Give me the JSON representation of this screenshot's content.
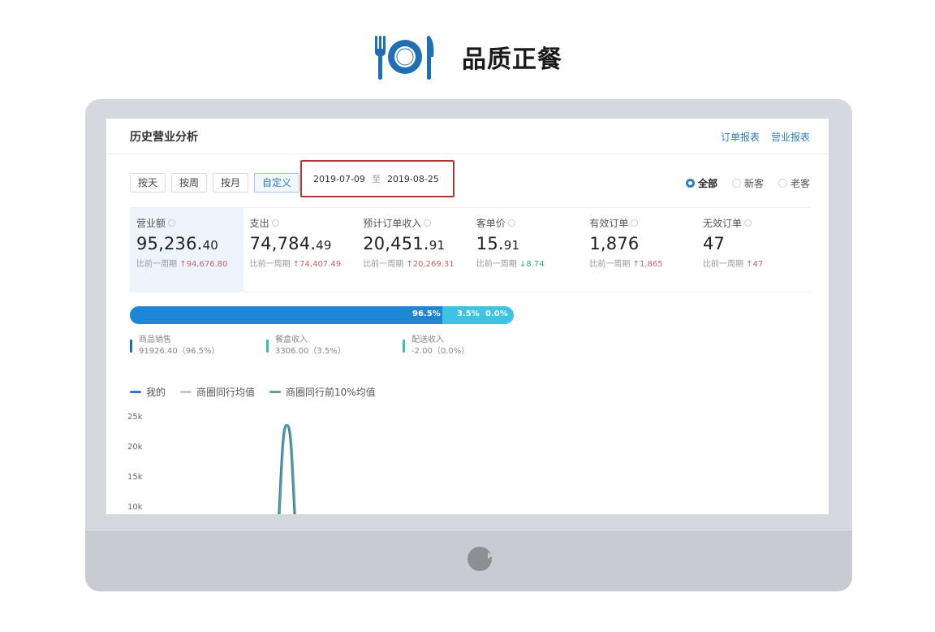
{
  "brand": {
    "title": "品质正餐",
    "logo_icon": "plate-fork-knife-icon",
    "accent": "#1f6fb5"
  },
  "screen": {
    "title": "历史营业分析",
    "links": [
      "订单报表",
      "营业报表"
    ],
    "period_buttons": [
      "按天",
      "按周",
      "按月",
      "自定义"
    ],
    "active_period": "自定义",
    "date_range": {
      "start": "2019-07-09",
      "separator": "至",
      "end": "2019-08-25"
    },
    "customer_filter": [
      {
        "label": "全部",
        "selected": true
      },
      {
        "label": "新客",
        "selected": false
      },
      {
        "label": "老客",
        "selected": false
      }
    ],
    "kpis": [
      {
        "label": "营业额",
        "int": "95,236.",
        "dec": "40",
        "compare_label": "比前一周期",
        "compare_value": "94,676.80",
        "trend": "up",
        "selected": true
      },
      {
        "label": "支出",
        "int": "74,784.",
        "dec": "49",
        "compare_label": "比前一周期",
        "compare_value": "74,407.49",
        "trend": "up",
        "selected": false
      },
      {
        "label": "预计订单收入",
        "int": "20,451.",
        "dec": "91",
        "compare_label": "比前一周期",
        "compare_value": "20,269.31",
        "trend": "up",
        "selected": false
      },
      {
        "label": "客单价",
        "int": "15.",
        "dec": "91",
        "compare_label": "比前一周期",
        "compare_value": "8.74",
        "trend": "down",
        "selected": false
      },
      {
        "label": "有效订单",
        "int": "1,876",
        "dec": "",
        "compare_label": "比前一周期",
        "compare_value": "1,865",
        "trend": "up",
        "selected": false
      },
      {
        "label": "无效订单",
        "int": "47",
        "dec": "",
        "compare_label": "比前一周期",
        "compare_value": "47",
        "trend": "up",
        "selected": false
      }
    ],
    "revenue_split": {
      "segments": [
        {
          "label": "96.5%",
          "percent": 96.5,
          "color": "#1f86d6"
        },
        {
          "label": "3.5%",
          "percent": 3.5,
          "color": "#3fc3e4"
        },
        {
          "label": "0.0%",
          "percent": 0.0,
          "color": "#3fc3e4"
        }
      ],
      "items": [
        {
          "name": "商品销售",
          "value": "91926.40（96.5%）",
          "color": "#1f6fb5"
        },
        {
          "name": "餐盒收入",
          "value": "3306.00（3.5%）",
          "color": "#3fbfa6"
        },
        {
          "name": "配送收入",
          "value": "-2.00（0.0%）",
          "color": "#3fbfa6"
        }
      ]
    },
    "series_legend": [
      {
        "name": "我的",
        "color": "#2f7bc1"
      },
      {
        "name": "商圈同行均值",
        "color": "#c4c7cc"
      },
      {
        "name": "商圈同行前10%均值",
        "color": "#5fa08a"
      }
    ],
    "chart_data": {
      "type": "line",
      "y_ticks": [
        "25k",
        "20k",
        "15k",
        "10k"
      ],
      "ylim": [
        10000,
        25000
      ],
      "series": [
        {
          "name": "我的",
          "color": "#2f7bc1",
          "peak": 23500
        },
        {
          "name": "商圈同行前10%均值",
          "color": "#5fa08a",
          "peak": 23500
        }
      ]
    }
  }
}
